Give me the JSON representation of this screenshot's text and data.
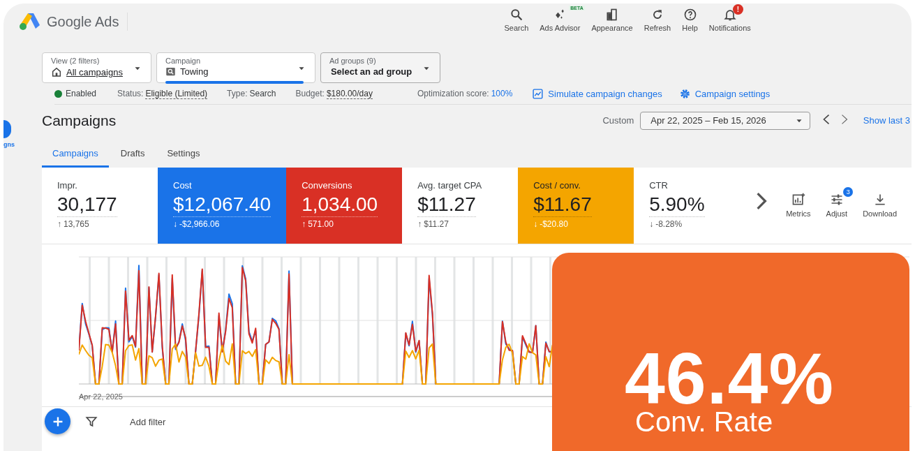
{
  "app": {
    "name": "Google Ads"
  },
  "toolbar": [
    {
      "kind": "search",
      "label": "Search"
    },
    {
      "kind": "advisor",
      "label": "Ads Advisor",
      "badge": "BETA"
    },
    {
      "kind": "appearance",
      "label": "Appearance"
    },
    {
      "kind": "refresh",
      "label": "Refresh"
    },
    {
      "kind": "help",
      "label": "Help"
    },
    {
      "kind": "notifications",
      "label": "Notifications",
      "badge": "!"
    }
  ],
  "sidebar": {
    "items": [
      {
        "label": "gns",
        "selected": true
      }
    ]
  },
  "filters": [
    {
      "kind": "view",
      "label": "View (2 filters)",
      "value": "All campaigns",
      "selected": false
    },
    {
      "kind": "campaign",
      "label": "Campaign",
      "value": "Towing",
      "selected": true
    },
    {
      "kind": "group",
      "label": "Ad groups (9)",
      "value": "Select an ad group",
      "selected": false
    }
  ],
  "status_row": {
    "state": "Enabled",
    "fields": [
      {
        "label": "Status:",
        "value": "Eligible (Limited)",
        "kind": "underlined"
      },
      {
        "label": "Type:",
        "value": "Search",
        "kind": "plain"
      },
      {
        "label": "Budget:",
        "value": "$180.00/day",
        "kind": "underlined"
      },
      {
        "label": "Optimization score:",
        "value": "100%",
        "kind": "link"
      }
    ],
    "links": [
      {
        "kind": "chart",
        "label": "Simulate campaign changes"
      },
      {
        "kind": "gear",
        "label": "Campaign settings"
      }
    ]
  },
  "header": {
    "title": "Campaigns",
    "range_label": "Custom",
    "date_range": "Apr 22, 2025 – Feb 15, 2026",
    "show_last": "Show last 3"
  },
  "tabs": [
    {
      "label": "Campaigns",
      "selected": true
    },
    {
      "label": "Drafts",
      "selected": false
    },
    {
      "label": "Settings",
      "selected": false
    }
  ],
  "metrics": [
    {
      "label": "Impr.",
      "value": "30,177",
      "arrow": "↑",
      "change": "13,765",
      "selected": false
    },
    {
      "label": "Cost",
      "value": "$12,067.40",
      "arrow": "↓",
      "change": "-$2,966.06",
      "selected": true,
      "color": "#1a73e8"
    },
    {
      "label": "Conversions",
      "value": "1,034.00",
      "arrow": "↑",
      "change": "571.00",
      "selected": true,
      "color": "#d93025"
    },
    {
      "label": "Avg. target CPA",
      "value": "$11.27",
      "arrow": "↑",
      "change": "$11.27",
      "selected": false
    },
    {
      "label": "Cost / conv.",
      "value": "$11.67",
      "arrow": "↓",
      "change": "-$20.80",
      "selected": true,
      "color": "#f4a500"
    },
    {
      "label": "CTR",
      "value": "5.90%",
      "arrow": "↓",
      "change": "-8.28%",
      "selected": false
    }
  ],
  "metric_tools": [
    {
      "kind": "metrics",
      "label": "Metrics"
    },
    {
      "kind": "adjust",
      "label": "Adjust",
      "badge": "3"
    },
    {
      "kind": "download",
      "label": "Download"
    }
  ],
  "chart": {
    "x_label": "Apr 22, 2025"
  },
  "filter_bar": {
    "label": "Add filter"
  },
  "highlight": {
    "value": "46.4%",
    "label": "Conv. Rate"
  }
}
